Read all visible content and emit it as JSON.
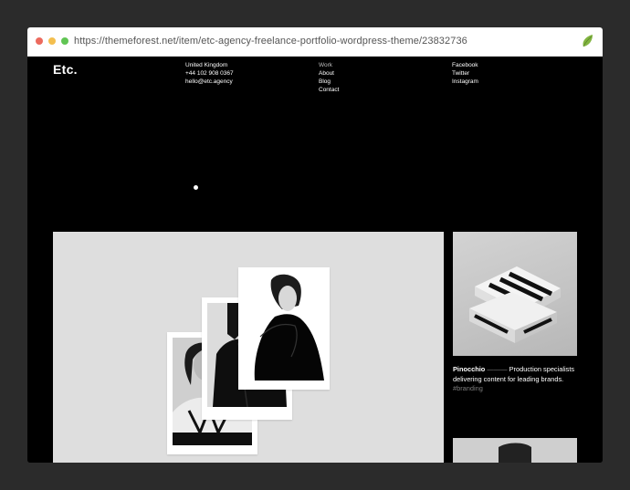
{
  "browser": {
    "url": "https://themeforest.net/item/etc-agency-freelance-portfolio-wordpress-theme/23832736",
    "dots": {
      "red": "#ec6a5e",
      "yellow": "#f4bf4f",
      "green": "#61c554"
    },
    "icon": "envato-leaf-icon",
    "icon_color": "#82b541"
  },
  "site": {
    "logo": "Etc.",
    "contact": {
      "location": "United Kingdom",
      "phone": "+44 102 908 0367",
      "email": "hello@etc.agency"
    },
    "nav": [
      {
        "label": "Work",
        "active": true
      },
      {
        "label": "About",
        "active": false
      },
      {
        "label": "Blog",
        "active": false
      },
      {
        "label": "Contact",
        "active": false
      }
    ],
    "social": [
      {
        "label": "Facebook"
      },
      {
        "label": "Twitter"
      },
      {
        "label": "Instagram"
      }
    ]
  },
  "portfolio": {
    "featured": {
      "images": [
        "portrait-fashion-1",
        "portrait-fashion-2",
        "portrait-fashion-3"
      ]
    },
    "side_project": {
      "name": "Pinocchio",
      "separator": "———",
      "description": "Production specialists delivering content for leading brands.",
      "tag": "#branding"
    }
  }
}
